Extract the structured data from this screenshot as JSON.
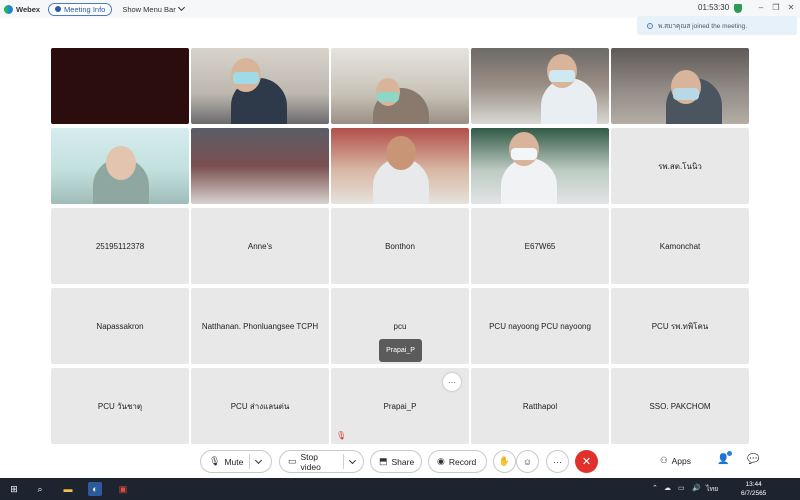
{
  "titlebar": {
    "app_name": "Webex",
    "meeting_info_label": "Meeting Info",
    "show_menu_label": "Show Menu Bar",
    "clock": "01:53:30",
    "window_buttons": [
      "–",
      "❐",
      "✕"
    ]
  },
  "toast": {
    "text": "พ.สมาคุณส joined the meeting."
  },
  "participants": [
    {
      "name": "",
      "video": true
    },
    {
      "name": "",
      "video": true
    },
    {
      "name": "",
      "video": true
    },
    {
      "name": "",
      "video": true
    },
    {
      "name": "",
      "video": true
    },
    {
      "name": "",
      "video": true
    },
    {
      "name": "",
      "video": true
    },
    {
      "name": "",
      "video": true
    },
    {
      "name": "",
      "video": true
    },
    {
      "name": "รพ.สต.โนนิว",
      "video": false
    },
    {
      "name": "25195112378",
      "video": false
    },
    {
      "name": "Anne's",
      "video": false
    },
    {
      "name": "Bonthon",
      "video": false
    },
    {
      "name": "E67W65",
      "video": false
    },
    {
      "name": "Kamonchat",
      "video": false
    },
    {
      "name": "Napassakron",
      "video": false
    },
    {
      "name": "Natthanan. Phonluangsee TCPH",
      "video": false
    },
    {
      "name": "pcu",
      "video": false
    },
    {
      "name": "PCU nayoong PCU nayoong",
      "video": false
    },
    {
      "name": "PCU รพ.ทพิโคน",
      "video": false
    },
    {
      "name": "PCU วันชาตุ",
      "video": false
    },
    {
      "name": "PCU ส่างแลนต่น",
      "video": false
    },
    {
      "name": "Prapai_P",
      "video": false
    },
    {
      "name": "Ratthapol",
      "video": false
    },
    {
      "name": "SSO. PAKCHOM",
      "video": false
    }
  ],
  "name_tag": "Prapai_P",
  "tile_more": "···",
  "controls": {
    "mute_label": "Mute",
    "stop_video_label": "Stop video",
    "share_label": "Share",
    "record_label": "Record",
    "more_label": "···",
    "apps_label": "Apps"
  },
  "taskbar": {
    "time": "13:44",
    "date": "6/7/2565",
    "lang": "ไทย"
  },
  "colors": {
    "leave": "#e0312d",
    "accent": "#2a7de1",
    "tile_bg": "#e8e8e8"
  }
}
